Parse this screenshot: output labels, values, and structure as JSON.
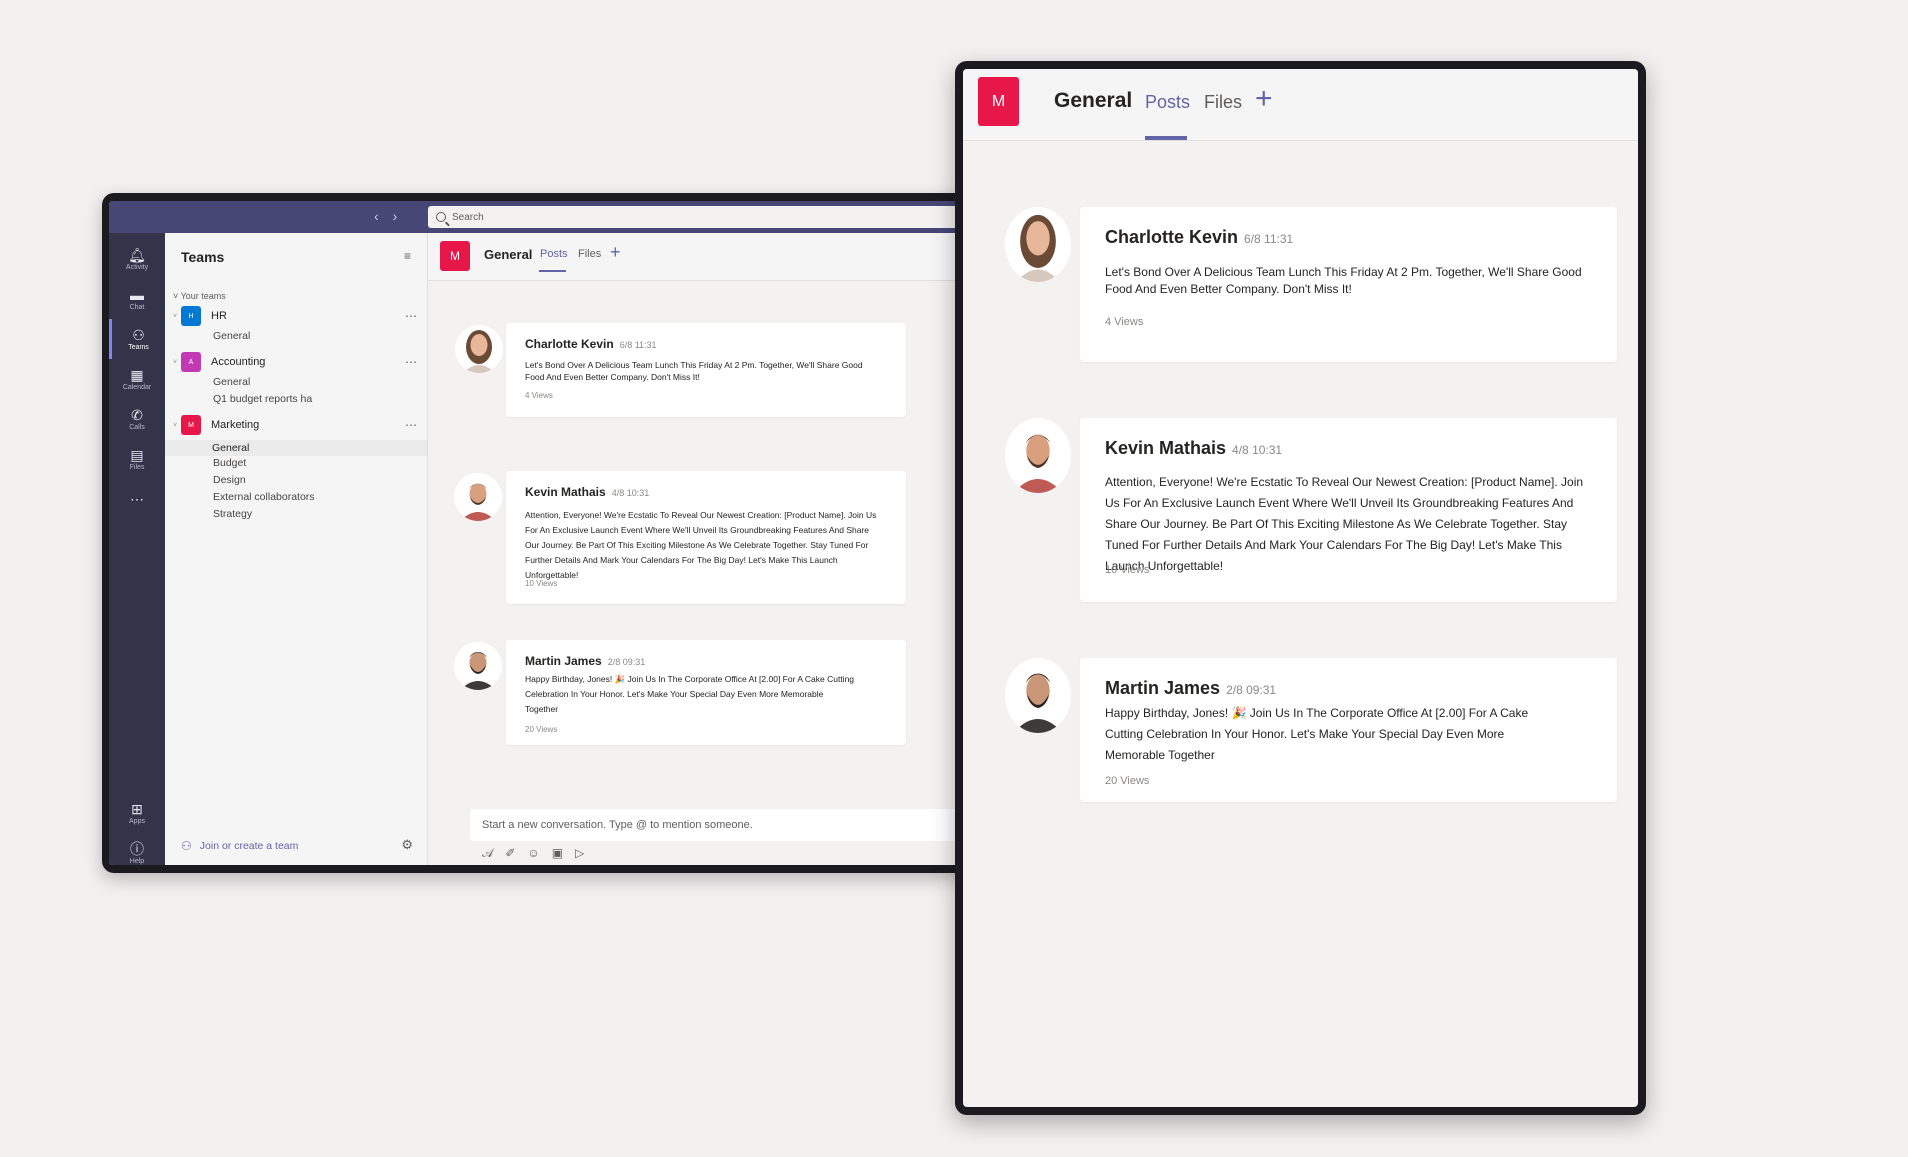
{
  "app": {
    "search_placeholder": "Search",
    "rail": [
      {
        "label": "Activity",
        "icon": "bell-icon"
      },
      {
        "label": "Chat",
        "icon": "chat-icon"
      },
      {
        "label": "Teams",
        "icon": "teams-icon"
      },
      {
        "label": "Calendar",
        "icon": "calendar-icon"
      },
      {
        "label": "Calls",
        "icon": "phone-icon"
      },
      {
        "label": "Files",
        "icon": "file-icon"
      },
      {
        "label": "Apps",
        "icon": "apps-icon"
      },
      {
        "label": "Help",
        "icon": "help-icon"
      }
    ],
    "teams_panel": {
      "title": "Teams",
      "section_label": "Your teams",
      "teams": [
        {
          "name": "HR",
          "badge": "H",
          "color": "#0078d4",
          "channels": [
            "General"
          ]
        },
        {
          "name": "Accounting",
          "badge": "A",
          "color": "#c239b3",
          "channels": [
            "General",
            "Q1 budget reports ha"
          ]
        },
        {
          "name": "Marketing",
          "badge": "M",
          "color": "#e8174a",
          "channels": [
            "General",
            "Budget",
            "Design",
            "External collaborators",
            "Strategy"
          ]
        }
      ],
      "join_label": "Join or create a team"
    },
    "channel": {
      "badge": "M",
      "title": "General",
      "tabs": [
        "Posts",
        "Files"
      ],
      "active_tab": "Posts",
      "accent": "#6264a7",
      "compose_placeholder": "Start a new conversation. Type @ to mention someone."
    },
    "posts": [
      {
        "author": "Charlotte Kevin",
        "time": "6/8 11:31",
        "body": "Let's Bond Over A Delicious Team Lunch This Friday At 2 Pm. Together, We'll Share Good Food And Even Better Company. Don't Miss It!",
        "views": "4 Views"
      },
      {
        "author": "Kevin Mathais",
        "time": "4/8 10:31",
        "body": "Attention, Everyone! We're Ecstatic To Reveal Our Newest Creation: [Product Name]. Join Us For An Exclusive Launch Event Where We'll Unveil Its Groundbreaking Features And Share Our Journey. Be Part Of This Exciting Milestone As We Celebrate Together. Stay Tuned For Further Details And Mark Your Calendars For The Big Day! Let's Make This Launch Unforgettable!",
        "views": "10 Views"
      },
      {
        "author": "Martin James",
        "time": "2/8 09:31",
        "body": "Happy Birthday, Jones! 🎉 Join Us In The Corporate Office At [2.00] For A Cake Cutting Celebration In Your Honor. Let's Make Your Special Day Even More Memorable Together",
        "views": "20 Views"
      }
    ]
  }
}
